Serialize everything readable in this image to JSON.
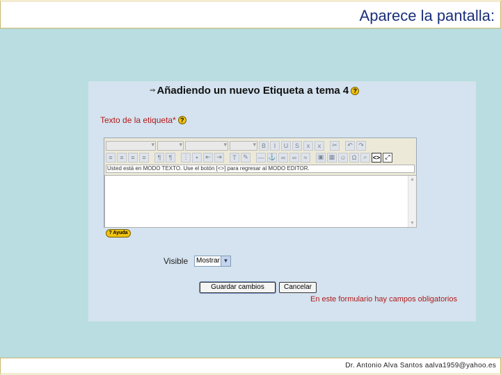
{
  "slide": {
    "title": "Aparece la pantalla:",
    "credit": "Dr. Antonio Alva Santos  aalva1959@yahoo.es"
  },
  "form": {
    "heading": "Añadiendo un nuevo Etiqueta a tema 4",
    "field_label": "Texto de la etiqueta*",
    "help_icon": "?",
    "editor_info": "Usted está en MODO TEXTO. Use el botón [<>] para regresar al MODO EDITOR.",
    "source_button": "<>",
    "help_badge": "? Ayuda",
    "visible_label": "Visible",
    "visible_value": "Mostrar",
    "save_button": "Guardar cambios",
    "cancel_button": "Cancelar",
    "required_note": "En este formulario hay campos obligatorios"
  }
}
